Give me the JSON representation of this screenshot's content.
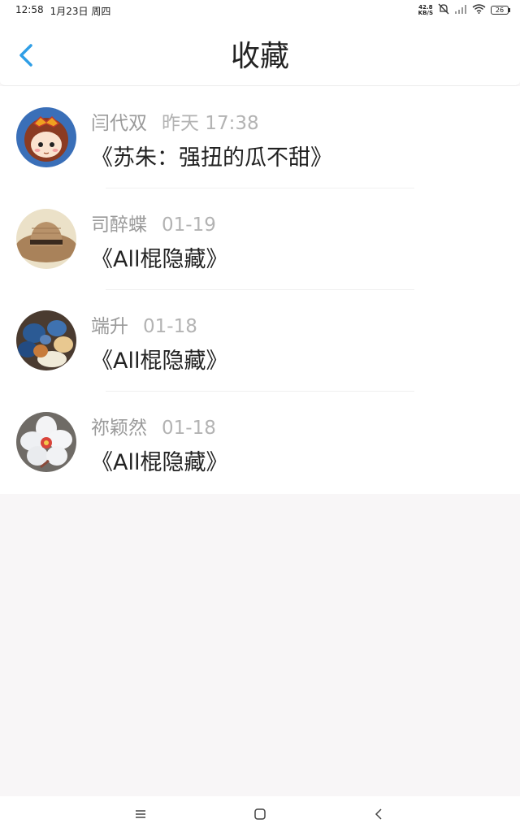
{
  "status_bar": {
    "time": "12:58",
    "date": "1月23日 周四",
    "net_speed_value": "42.8",
    "net_speed_unit": "KB/S",
    "battery": "26",
    "icons": [
      "mute-icon",
      "signal-icon",
      "wifi-icon",
      "battery-icon"
    ]
  },
  "header": {
    "title": "收藏",
    "back_icon": "chevron-left-icon",
    "accent_color": "#2f9ee6"
  },
  "favorites": [
    {
      "author": "闫代双",
      "time": "昨天 17:38",
      "title": "《苏朱：强扭的瓜不甜》",
      "avatar": "cartoon-girl-avatar"
    },
    {
      "author": "司醉蝶",
      "time": "01-19",
      "title": "《All棍隐藏》",
      "avatar": "straw-hat-avatar"
    },
    {
      "author": "端升",
      "time": "01-18",
      "title": "《All棍隐藏》",
      "avatar": "seashells-avatar"
    },
    {
      "author": "祢颖然",
      "time": "01-18",
      "title": "《All棍隐藏》",
      "avatar": "white-flower-avatar"
    }
  ],
  "nav_bar": {
    "icons": [
      "menu-icon",
      "home-icon",
      "back-icon"
    ]
  }
}
